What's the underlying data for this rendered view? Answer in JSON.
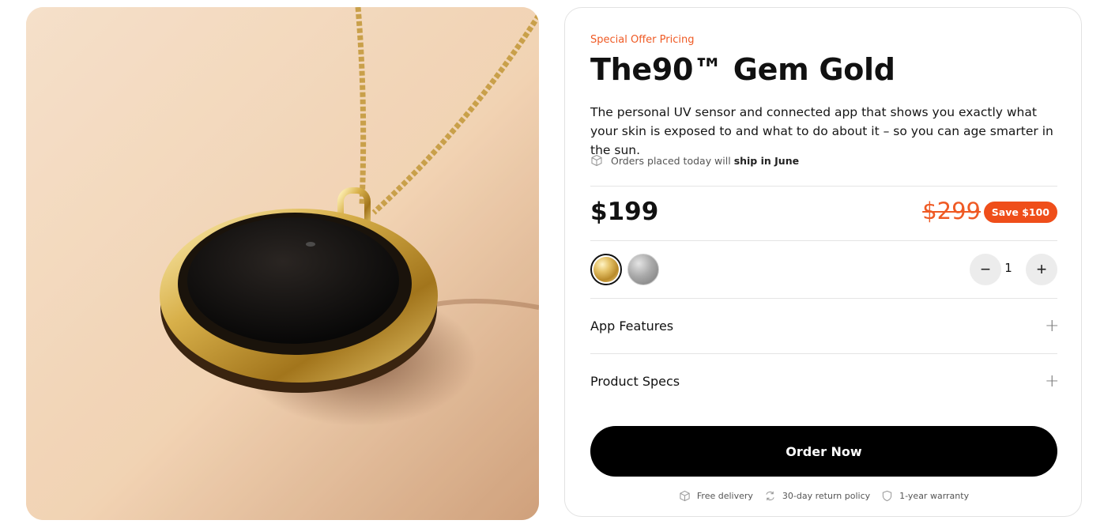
{
  "product": {
    "offer_label": "Special Offer Pricing",
    "title": "The90™ Gem Gold",
    "description": "The personal UV sensor and connected app that shows you exactly what your skin is exposed to and what to do about it – so you can age smarter in the sun.",
    "shipping": {
      "prefix": "Orders placed today will",
      "highlight": "ship in June"
    }
  },
  "pricing": {
    "price": "$199",
    "old_price": "$299",
    "save_badge": "Save $100"
  },
  "variants": [
    {
      "name": "gold",
      "selected": true
    },
    {
      "name": "silver",
      "selected": false
    }
  ],
  "quantity": {
    "minus": "−",
    "value": "1",
    "plus": "+"
  },
  "accordion": [
    {
      "label": "App Features",
      "icon": "+"
    },
    {
      "label": "Product Specs",
      "icon": "+"
    }
  ],
  "cta": {
    "label": "Order Now"
  },
  "perks": [
    {
      "icon": "box-icon",
      "label": "Free delivery"
    },
    {
      "icon": "return-icon",
      "label": "30-day return policy"
    },
    {
      "icon": "shield-icon",
      "label": "1-year warranty"
    }
  ],
  "colors": {
    "accent": "#ef5a24",
    "badge": "#ef4e1a",
    "cta_bg": "#000000"
  }
}
